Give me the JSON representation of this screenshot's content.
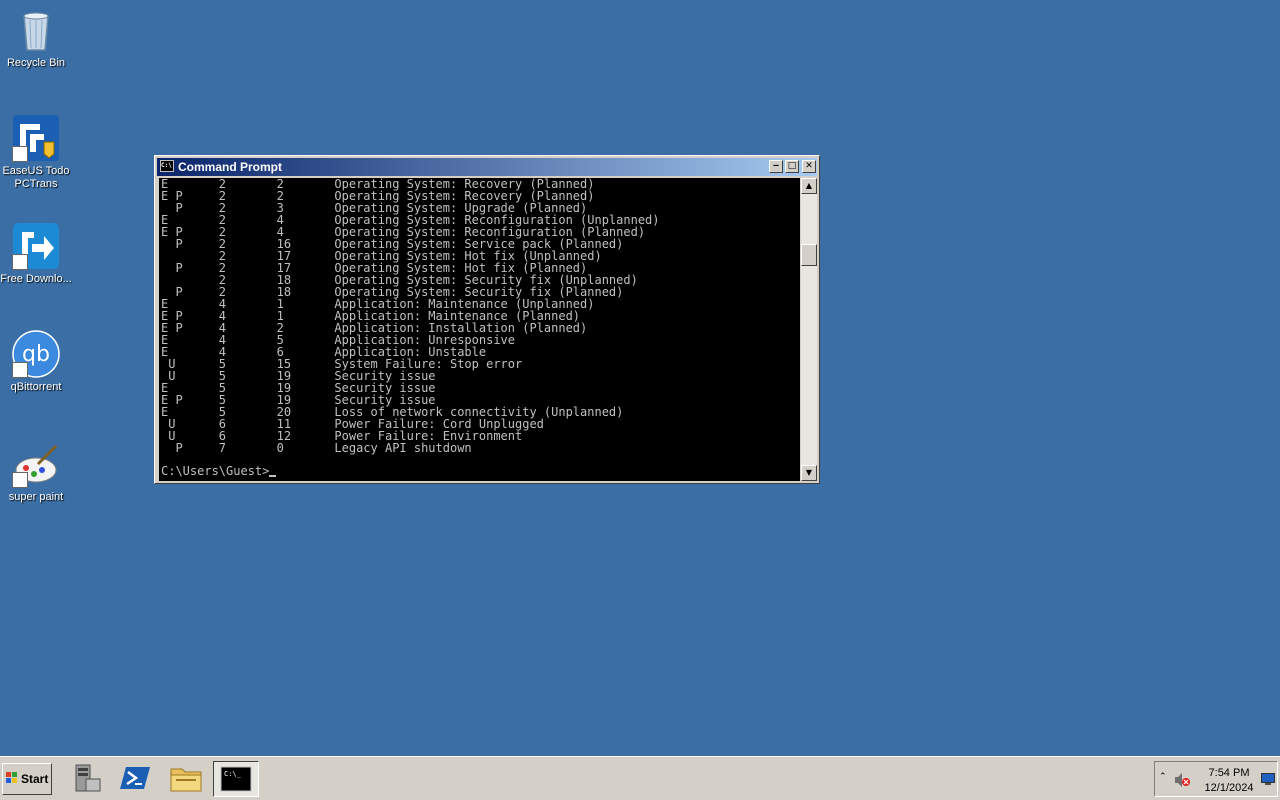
{
  "desktop": {
    "icons": [
      {
        "label": "Recycle Bin",
        "icon": "recycle-bin-icon"
      },
      {
        "label": "EaseUS Todo PCTrans",
        "icon": "easeus-icon"
      },
      {
        "label": "Free Downlo...",
        "icon": "free-download-icon"
      },
      {
        "label": "qBittorrent",
        "icon": "qbittorrent-icon"
      },
      {
        "label": "super paint",
        "icon": "super-paint-icon"
      }
    ]
  },
  "window": {
    "title": "Command Prompt",
    "console_lines": [
      "E       2       2       Operating System: Recovery (Planned)",
      "E P     2       2       Operating System: Recovery (Planned)",
      "  P     2       3       Operating System: Upgrade (Planned)",
      "E       2       4       Operating System: Reconfiguration (Unplanned)",
      "E P     2       4       Operating System: Reconfiguration (Planned)",
      "  P     2       16      Operating System: Service pack (Planned)",
      "        2       17      Operating System: Hot fix (Unplanned)",
      "  P     2       17      Operating System: Hot fix (Planned)",
      "        2       18      Operating System: Security fix (Unplanned)",
      "  P     2       18      Operating System: Security fix (Planned)",
      "E       4       1       Application: Maintenance (Unplanned)",
      "E P     4       1       Application: Maintenance (Planned)",
      "E P     4       2       Application: Installation (Planned)",
      "E       4       5       Application: Unresponsive",
      "E       4       6       Application: Unstable",
      " U      5       15      System Failure: Stop error",
      " U      5       19      Security issue",
      "E       5       19      Security issue",
      "E P     5       19      Security issue",
      "E       5       20      Loss of network connectivity (Unplanned)",
      " U      6       11      Power Failure: Cord Unplugged",
      " U      6       12      Power Failure: Environment",
      "  P     7       0       Legacy API shutdown"
    ],
    "prompt": "C:\\Users\\Guest>"
  },
  "taskbar": {
    "start_label": "Start",
    "apps": [
      {
        "icon": "server-manager-icon"
      },
      {
        "icon": "powershell-icon"
      },
      {
        "icon": "file-explorer-icon"
      },
      {
        "icon": "command-prompt-icon",
        "active": true
      }
    ],
    "clock": {
      "time": "7:54 PM",
      "date": "12/1/2024"
    }
  },
  "colors": {
    "desktop": "#3a6ea5",
    "titlebar": "#0a246a",
    "console_bg": "#000000",
    "console_fg": "#c0c0c0"
  }
}
